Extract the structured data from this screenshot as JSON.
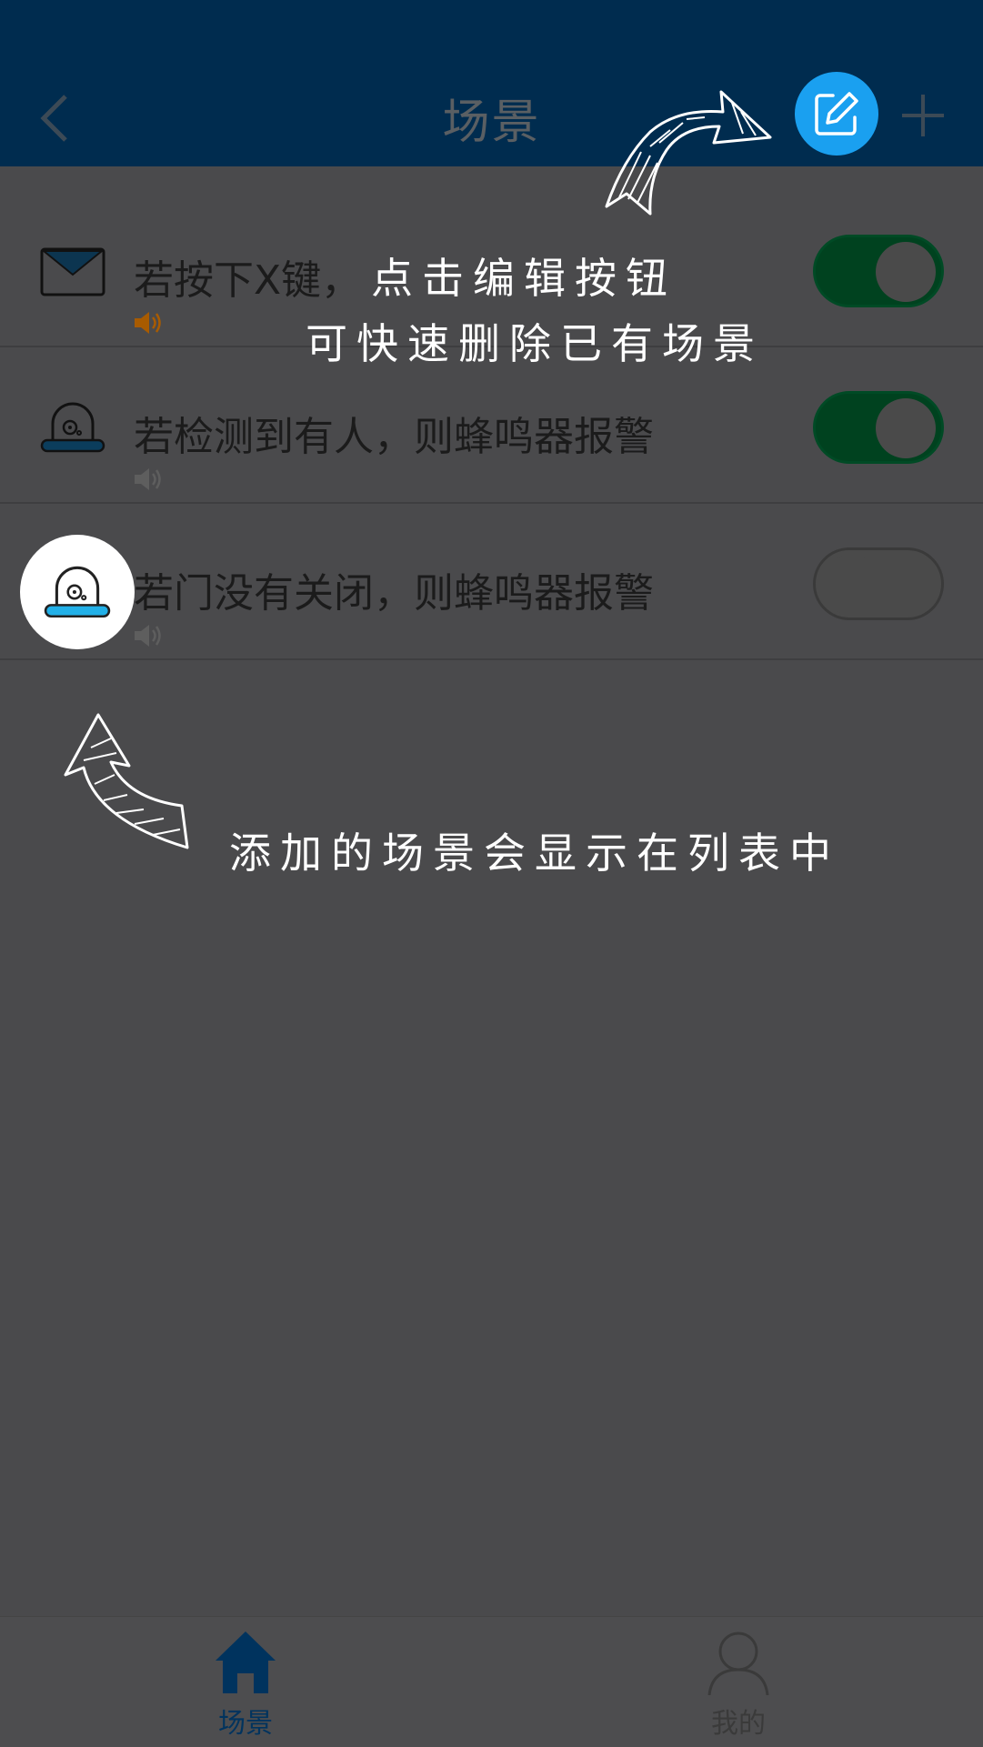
{
  "header": {
    "title": "场景",
    "back_icon": "chevron-left-icon",
    "edit_icon": "edit-icon",
    "add_icon": "plus-icon"
  },
  "scenes": [
    {
      "label": "若按下X键，",
      "icon": "envelope-icon",
      "sound_icon": "speaker-icon",
      "sound_active": true,
      "enabled": true
    },
    {
      "label": "若检测到有人，则蜂鸣器报警",
      "icon": "siren-icon",
      "sound_icon": "speaker-icon",
      "sound_active": false,
      "enabled": true
    },
    {
      "label": "若门没有关闭，则蜂鸣器报警",
      "icon": "siren-icon",
      "sound_icon": "speaker-icon",
      "sound_active": false,
      "enabled": false
    }
  ],
  "hints": {
    "edit_line1": "点击编辑按钮",
    "edit_line2": "可快速删除已有场景",
    "list_hint": "添加的场景会显示在列表中"
  },
  "tabbar": {
    "tabs": [
      {
        "label": "场景",
        "icon": "home-icon",
        "active": true
      },
      {
        "label": "我的",
        "icon": "user-icon",
        "active": false
      }
    ]
  },
  "colors": {
    "header_bg": "#002c4f",
    "overlay_bg": "#4a4a4c",
    "toggle_on": "#00421f",
    "edit_button": "#1aa0f0",
    "tab_active": "#00335e"
  }
}
